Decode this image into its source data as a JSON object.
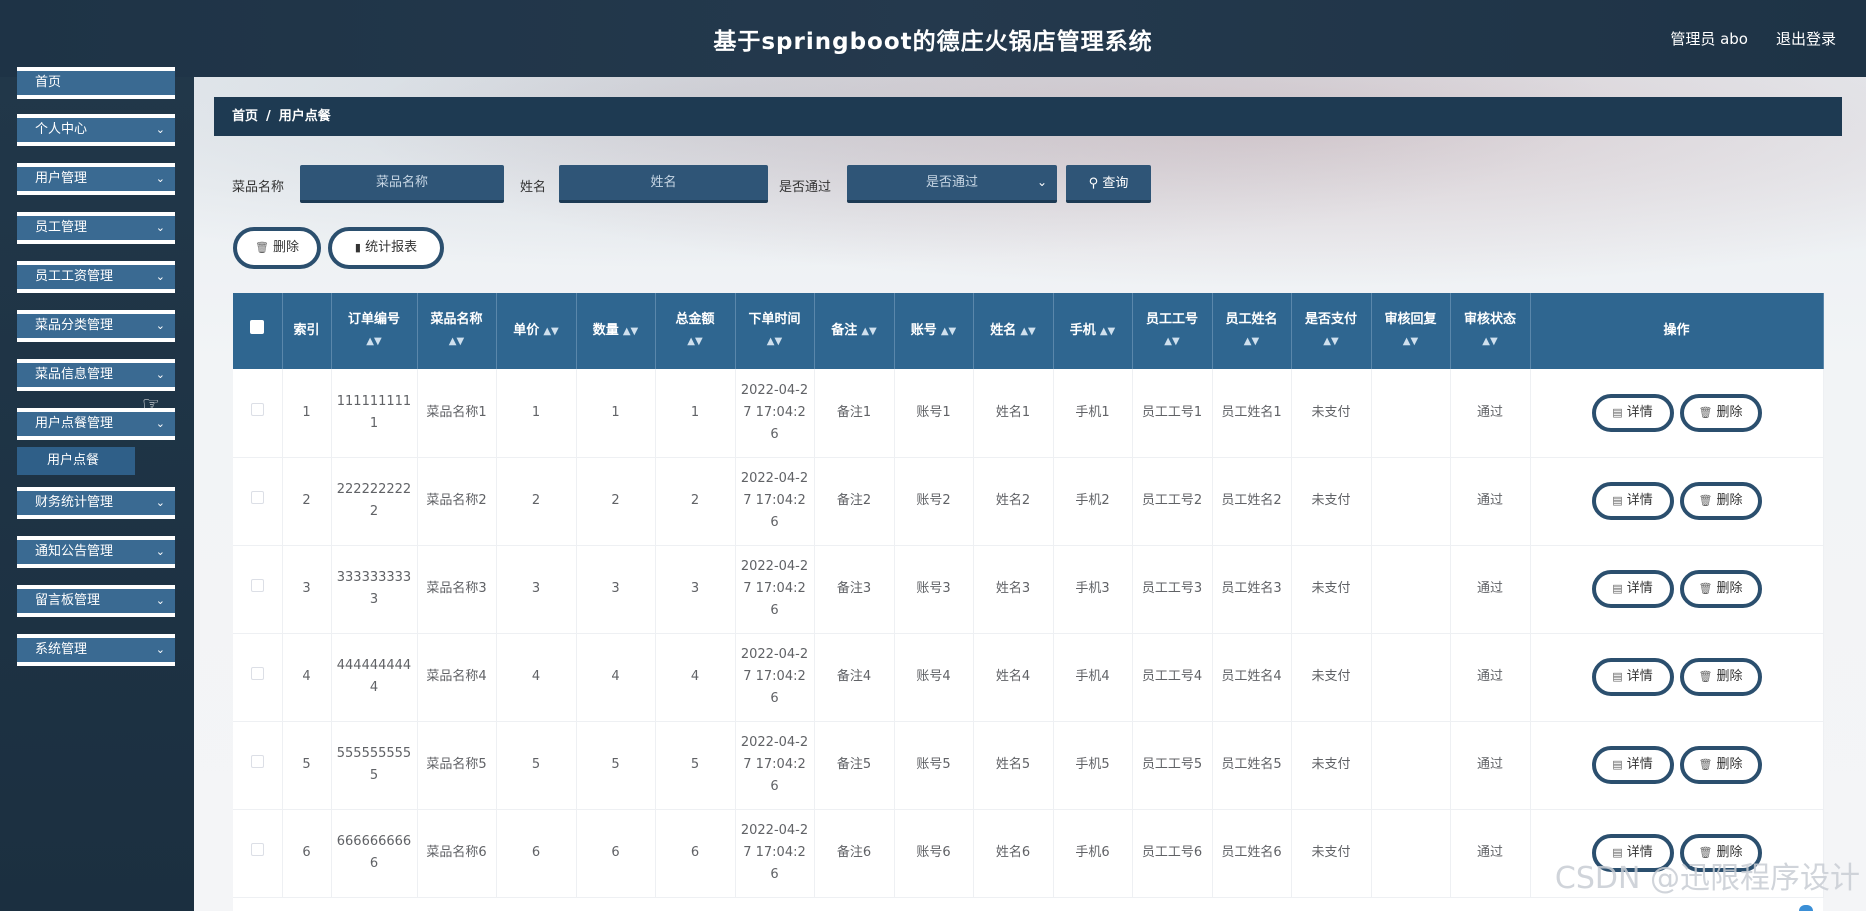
{
  "header": {
    "title": "基于springboot的德庄火锅店管理系统",
    "user": "管理员 abo",
    "logout": "退出登录"
  },
  "sidebar": {
    "items": [
      {
        "label": "首页"
      },
      {
        "label": "个人中心"
      },
      {
        "label": "用户管理"
      },
      {
        "label": "员工管理"
      },
      {
        "label": "员工工资管理"
      },
      {
        "label": "菜品分类管理"
      },
      {
        "label": "菜品信息管理"
      },
      {
        "label": "用户点餐管理"
      },
      {
        "label": "财务统计管理"
      },
      {
        "label": "通知公告管理"
      },
      {
        "label": "留言板管理"
      },
      {
        "label": "系统管理"
      }
    ],
    "submenu": {
      "label": "用户点餐"
    }
  },
  "breadcrumb": {
    "home": "首页",
    "sep": "/",
    "current": "用户点餐"
  },
  "search": {
    "dish_label": "菜品名称",
    "dish_placeholder": "菜品名称",
    "name_label": "姓名",
    "name_placeholder": "姓名",
    "pass_label": "是否通过",
    "pass_placeholder": "是否通过",
    "query_button": "查询"
  },
  "actions": {
    "delete": "删除",
    "report": "统计报表"
  },
  "table": {
    "headers": [
      "索引",
      "订单编号",
      "菜品名称",
      "单价",
      "数量",
      "总金额",
      "下单时间",
      "备注",
      "账号",
      "姓名",
      "手机",
      "员工工号",
      "员工姓名",
      "是否支付",
      "审核回复",
      "审核状态",
      "操作"
    ],
    "detail_label": "详情",
    "delete_label": "删除",
    "rows": [
      {
        "idx": "1",
        "order": "1111111111",
        "dish": "菜品名称1",
        "price": "1",
        "qty": "1",
        "total": "1",
        "time": "2022-04-27 17:04:26",
        "remark": "备注1",
        "account": "账号1",
        "name": "姓名1",
        "phone": "手机1",
        "emp_no": "员工工号1",
        "emp_name": "员工姓名1",
        "paid": "未支付",
        "reply": "",
        "status": "通过"
      },
      {
        "idx": "2",
        "order": "2222222222",
        "dish": "菜品名称2",
        "price": "2",
        "qty": "2",
        "total": "2",
        "time": "2022-04-27 17:04:26",
        "remark": "备注2",
        "account": "账号2",
        "name": "姓名2",
        "phone": "手机2",
        "emp_no": "员工工号2",
        "emp_name": "员工姓名2",
        "paid": "未支付",
        "reply": "",
        "status": "通过"
      },
      {
        "idx": "3",
        "order": "3333333333",
        "dish": "菜品名称3",
        "price": "3",
        "qty": "3",
        "total": "3",
        "time": "2022-04-27 17:04:26",
        "remark": "备注3",
        "account": "账号3",
        "name": "姓名3",
        "phone": "手机3",
        "emp_no": "员工工号3",
        "emp_name": "员工姓名3",
        "paid": "未支付",
        "reply": "",
        "status": "通过"
      },
      {
        "idx": "4",
        "order": "4444444444",
        "dish": "菜品名称4",
        "price": "4",
        "qty": "4",
        "total": "4",
        "time": "2022-04-27 17:04:26",
        "remark": "备注4",
        "account": "账号4",
        "name": "姓名4",
        "phone": "手机4",
        "emp_no": "员工工号4",
        "emp_name": "员工姓名4",
        "paid": "未支付",
        "reply": "",
        "status": "通过"
      },
      {
        "idx": "5",
        "order": "5555555555",
        "dish": "菜品名称5",
        "price": "5",
        "qty": "5",
        "total": "5",
        "time": "2022-04-27 17:04:26",
        "remark": "备注5",
        "account": "账号5",
        "name": "姓名5",
        "phone": "手机5",
        "emp_no": "员工工号5",
        "emp_name": "员工姓名5",
        "paid": "未支付",
        "reply": "",
        "status": "通过"
      },
      {
        "idx": "6",
        "order": "6666666666",
        "dish": "菜品名称6",
        "price": "6",
        "qty": "6",
        "total": "6",
        "time": "2022-04-27 17:04:26",
        "remark": "备注6",
        "account": "账号6",
        "name": "姓名6",
        "phone": "手机6",
        "emp_no": "员工工号6",
        "emp_name": "员工姓名6",
        "paid": "未支付",
        "reply": "",
        "status": "通过"
      }
    ]
  },
  "watermark": "CSDN @迅限程序设计"
}
